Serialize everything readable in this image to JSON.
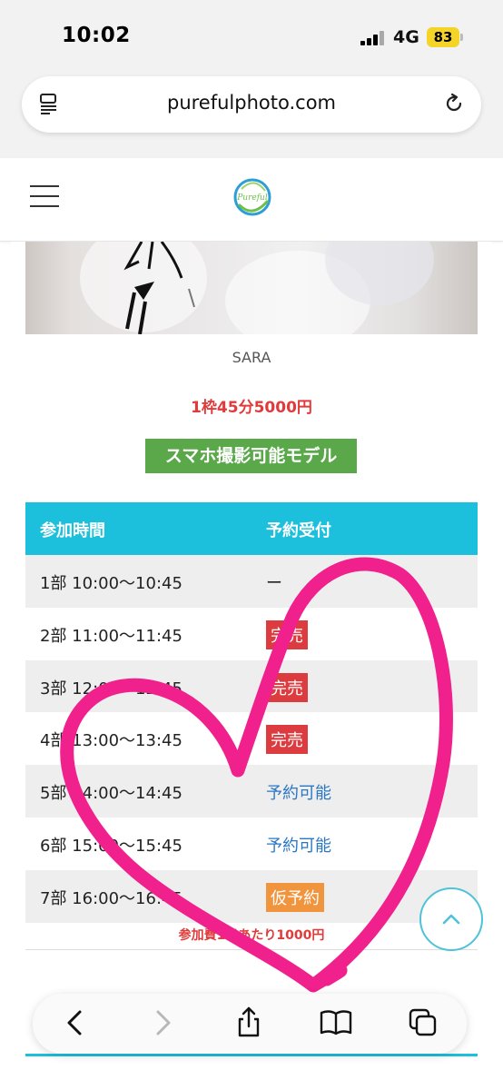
{
  "status_bar": {
    "time": "10:02",
    "network": "4G",
    "battery": "83",
    "battery_color": "#f5d428"
  },
  "browser": {
    "url": "purefulphoto.com",
    "reader_icon": "reader-icon",
    "reload_icon": "reload-icon"
  },
  "site": {
    "menu_icon": "hamburger-icon",
    "logo_text": "Pureful",
    "logo_colors": [
      "#2e9ed6",
      "#6cc04a"
    ]
  },
  "model": {
    "name": "SARA",
    "price": "1枠45分5000円",
    "badge": "スマホ撮影可能モデル",
    "badge_color": "#5aa84a",
    "price_color": "#e03a3a"
  },
  "schedule": {
    "header_color": "#1cc0dc",
    "headers": [
      "参加時間",
      "予約受付"
    ],
    "rows": [
      {
        "time": "1部 10:00〜10:45",
        "status": "ー",
        "kind": "dash"
      },
      {
        "time": "2部 11:00〜11:45",
        "status": "完売",
        "kind": "soldout"
      },
      {
        "time": "3部 12:00〜12:45",
        "status": "完売",
        "kind": "soldout"
      },
      {
        "time": "4部 13:00〜13:45",
        "status": "完売",
        "kind": "soldout"
      },
      {
        "time": "5部 14:00〜14:45",
        "status": "予約可能",
        "kind": "available"
      },
      {
        "time": "6部 15:00〜15:45",
        "status": "予約可能",
        "kind": "available"
      },
      {
        "time": "7部 16:00〜16:45",
        "status": "仮予約",
        "kind": "temp"
      }
    ],
    "fee_note": "参加費1日あたり1000円",
    "status_colors": {
      "soldout": "#dc3b3f",
      "available": "#2b77c4",
      "temp": "#f0953e"
    }
  },
  "overlay": {
    "heart_color": "#f0208c"
  },
  "toolbar": {
    "icons": [
      "back-icon",
      "forward-icon",
      "share-icon",
      "bookmarks-icon",
      "tabs-icon"
    ]
  }
}
